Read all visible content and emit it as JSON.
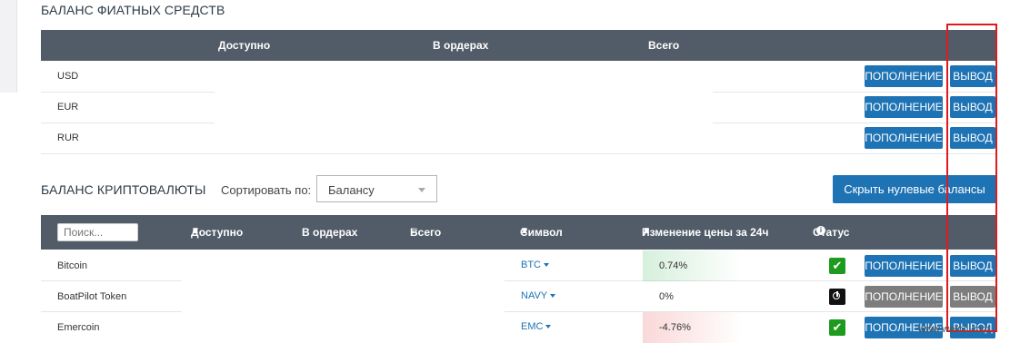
{
  "fiat": {
    "title": "БАЛАНС ФИАТНЫХ СРЕДСТВ",
    "headers": {
      "available": "Доступно",
      "in_orders": "В ордерах",
      "total": "Всего"
    },
    "rows": [
      {
        "currency": "USD",
        "deposit": "ПОПОЛНЕНИЕ",
        "withdraw": "ВЫВОД"
      },
      {
        "currency": "EUR",
        "deposit": "ПОПОЛНЕНИЕ",
        "withdraw": "ВЫВОД"
      },
      {
        "currency": "RUR",
        "deposit": "ПОПОЛНЕНИЕ",
        "withdraw": "ВЫВОД"
      }
    ]
  },
  "crypto": {
    "title": "БАЛАНС КРИПТОВАЛЮТЫ",
    "sort_label": "Сортировать по:",
    "sort_value": "Балансу",
    "hide_zero": "Скрыть нулевые балансы",
    "search_placeholder": "Поиск...",
    "headers": {
      "available": "Доступно",
      "in_orders": "В ордерах",
      "total": "Всего",
      "symbol": "Символ",
      "change": "Изменение цены за 24ч",
      "status": "Статус"
    },
    "sort_arrows": {
      "up": "▲",
      "down": "▼"
    },
    "rows": [
      {
        "name": "Bitcoin",
        "symbol": "BTC",
        "change": "0.74%",
        "status": "check",
        "deposit": "ПОПОЛНЕНИЕ",
        "withdraw": "ВЫВОД",
        "enabled": true
      },
      {
        "name": "BoatPilot Token",
        "symbol": "NAVY",
        "change": "0%",
        "status": "power",
        "deposit": "ПОПОЛНЕНИЕ",
        "withdraw": "ВЫВОД",
        "enabled": false
      },
      {
        "name": "Emercoin",
        "symbol": "EMC",
        "change": "-4.76%",
        "status": "check",
        "deposit": "ПОПОЛНЕНИЕ",
        "withdraw": "ВЫВОД",
        "enabled": true
      }
    ]
  },
  "watermark": "www.wetoc.com",
  "colors": {
    "header_bg": "#525c68",
    "button_blue": "#1e73b4",
    "button_gray": "#7d7d7d",
    "status_green": "#1e9a1e",
    "highlight_red": "#e0191e"
  }
}
